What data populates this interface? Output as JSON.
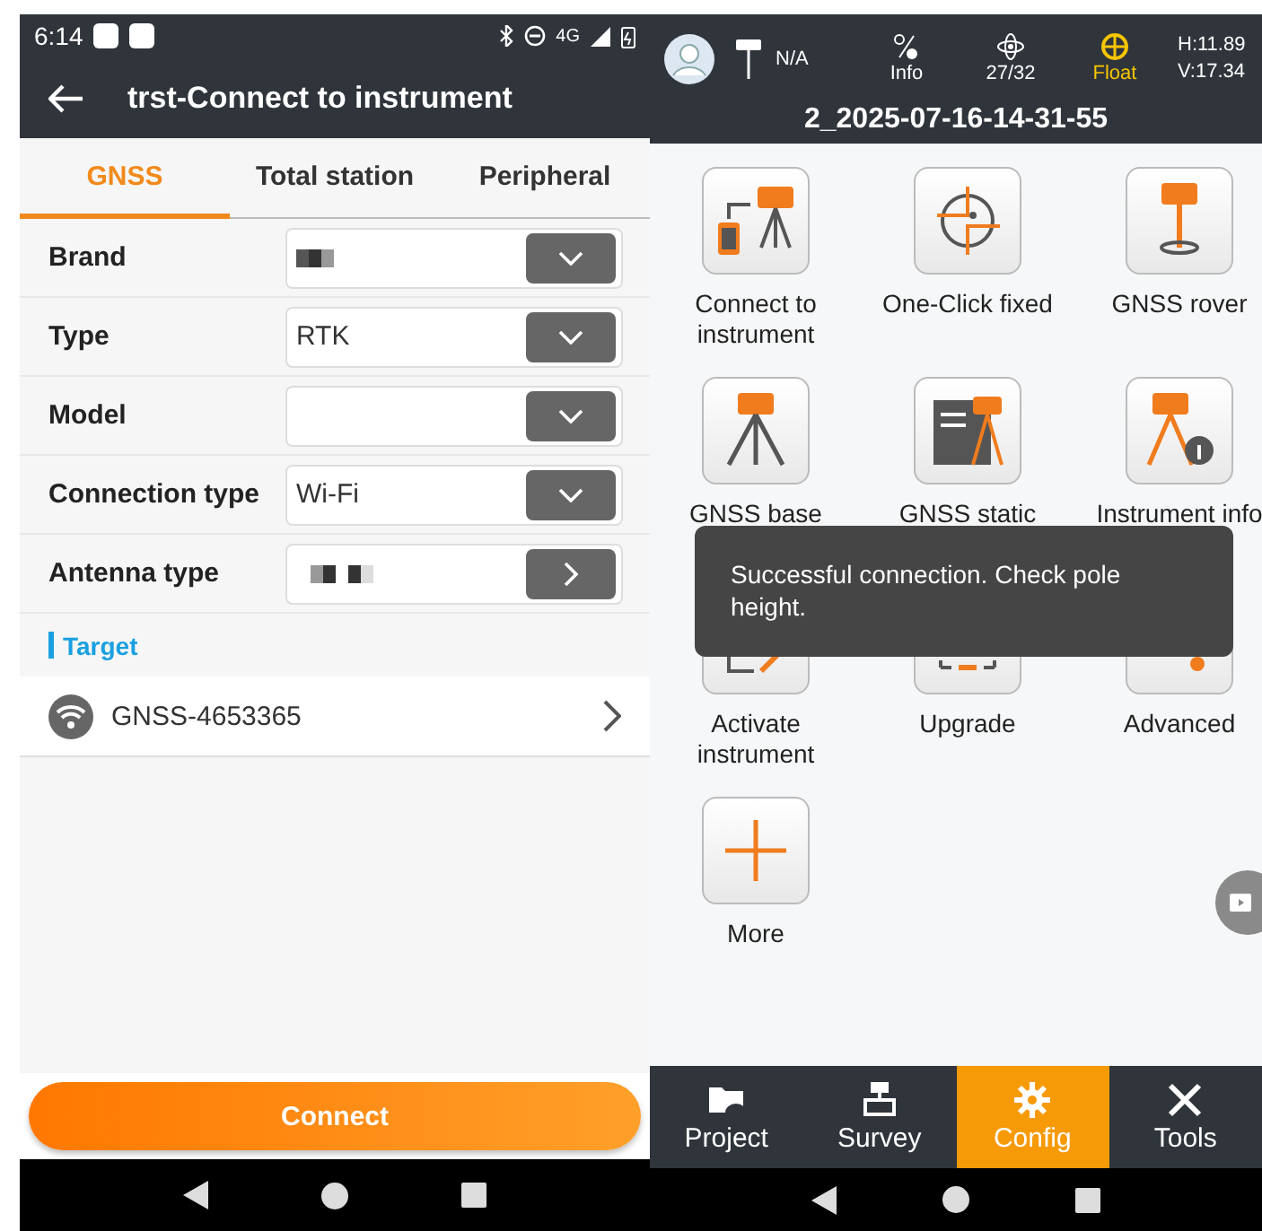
{
  "left_status_bar": {
    "time": "6:14",
    "network": "4G"
  },
  "header": {
    "title": "trst-Connect to instrument"
  },
  "tabs": [
    {
      "label": "GNSS",
      "selected": true
    },
    {
      "label": "Total station",
      "selected": false
    },
    {
      "label": "Peripheral",
      "selected": false
    }
  ],
  "form": [
    {
      "label": "Brand",
      "redacted": true,
      "kind": "dropdown"
    },
    {
      "label": "Type",
      "value": "RTK",
      "kind": "dropdown"
    },
    {
      "label": "Model",
      "kind": "dropdown"
    },
    {
      "label": "Connection type",
      "value": "Wi-Fi",
      "kind": "dropdown"
    },
    {
      "label": "Antenna type",
      "redacted": true,
      "kind": "link"
    }
  ],
  "target": {
    "heading": "Target",
    "devices": [
      {
        "name": "GNSS-4653365"
      }
    ]
  },
  "connect_button": "Connect",
  "right_status_bar": {
    "base": "N/A",
    "info": "Info",
    "satellites": "27/32",
    "solution": "Float",
    "h": "H:11.89",
    "v": "V:17.34"
  },
  "project_name": "2_2025-07-16-14-31-55",
  "tiles": [
    {
      "label": "Connect to instrument"
    },
    {
      "label": "One-Click fixed"
    },
    {
      "label": "GNSS rover"
    },
    {
      "label": "GNSS base"
    },
    {
      "label": "GNSS static"
    },
    {
      "label": "Instrument info"
    },
    {
      "label": "Activate instrument"
    },
    {
      "label": "Upgrade"
    },
    {
      "label": "Advanced"
    },
    {
      "label": "More"
    }
  ],
  "toast": "Successful connection. Check pole height.",
  "bottom_tabs": [
    {
      "label": "Project",
      "selected": false
    },
    {
      "label": "Survey",
      "selected": false
    },
    {
      "label": "Config",
      "selected": true
    },
    {
      "label": "Tools",
      "selected": false
    }
  ]
}
